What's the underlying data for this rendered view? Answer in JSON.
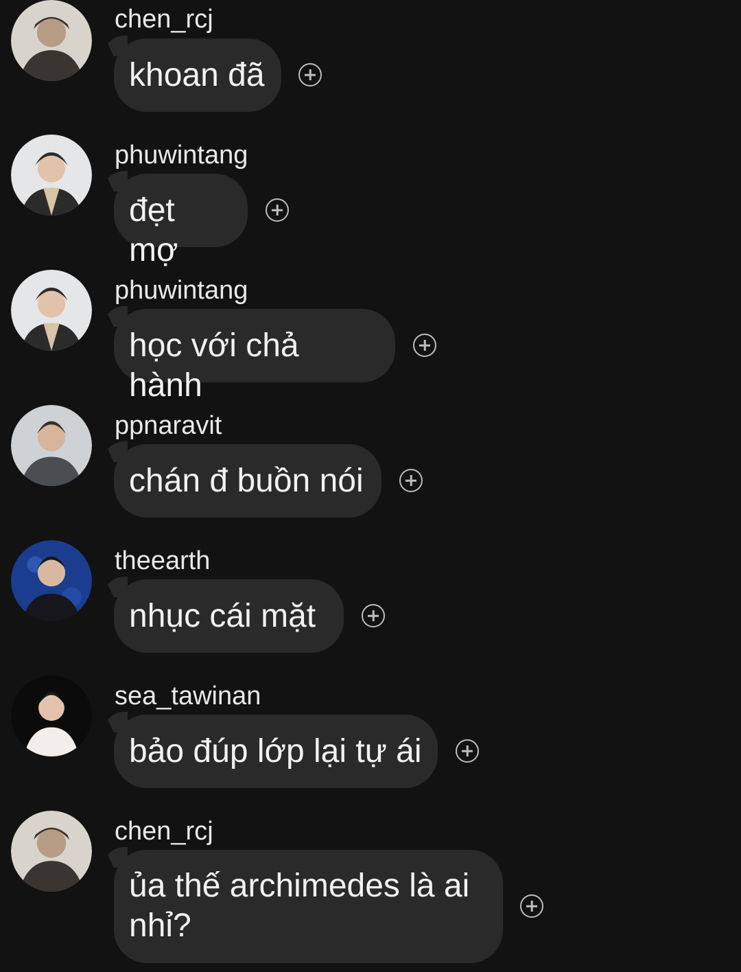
{
  "messages": [
    {
      "username": "chen_rcj",
      "text": "khoan đã",
      "avatar": "avatar-chen-rcj",
      "avatar_bg": "#d8d4cc",
      "avatar_fg": "#3a3530"
    },
    {
      "username": "phuwintang",
      "text": "đẹt mợ",
      "avatar": "avatar-phuwintang",
      "avatar_bg": "#e4e6e8",
      "avatar_fg": "#2b2b2b"
    },
    {
      "username": "phuwintang",
      "text": "học với chả hành",
      "avatar": "avatar-phuwintang",
      "avatar_bg": "#e4e6e8",
      "avatar_fg": "#2b2b2b"
    },
    {
      "username": "ppnaravit",
      "text": "chán đ buồn nói",
      "avatar": "avatar-ppnaravit",
      "avatar_bg": "#cfd2d4",
      "avatar_fg": "#4a4d52"
    },
    {
      "username": "theearth",
      "text": "nhục cái mặt",
      "avatar": "avatar-theearth",
      "avatar_bg": "#1b3d8f",
      "avatar_fg": "#16161c"
    },
    {
      "username": "sea_tawinan",
      "text": "bảo đúp lớp lại tự ái",
      "avatar": "avatar-sea-tawinan",
      "avatar_bg": "#0b0b0b",
      "avatar_fg": "#f3eeea"
    },
    {
      "username": "chen_rcj",
      "text": "ủa thế archimedes là ai nhỉ?",
      "avatar": "avatar-chen-rcj",
      "avatar_bg": "#d8d4cc",
      "avatar_fg": "#3a3530"
    }
  ],
  "icons": {
    "react": "add-reaction-icon"
  }
}
